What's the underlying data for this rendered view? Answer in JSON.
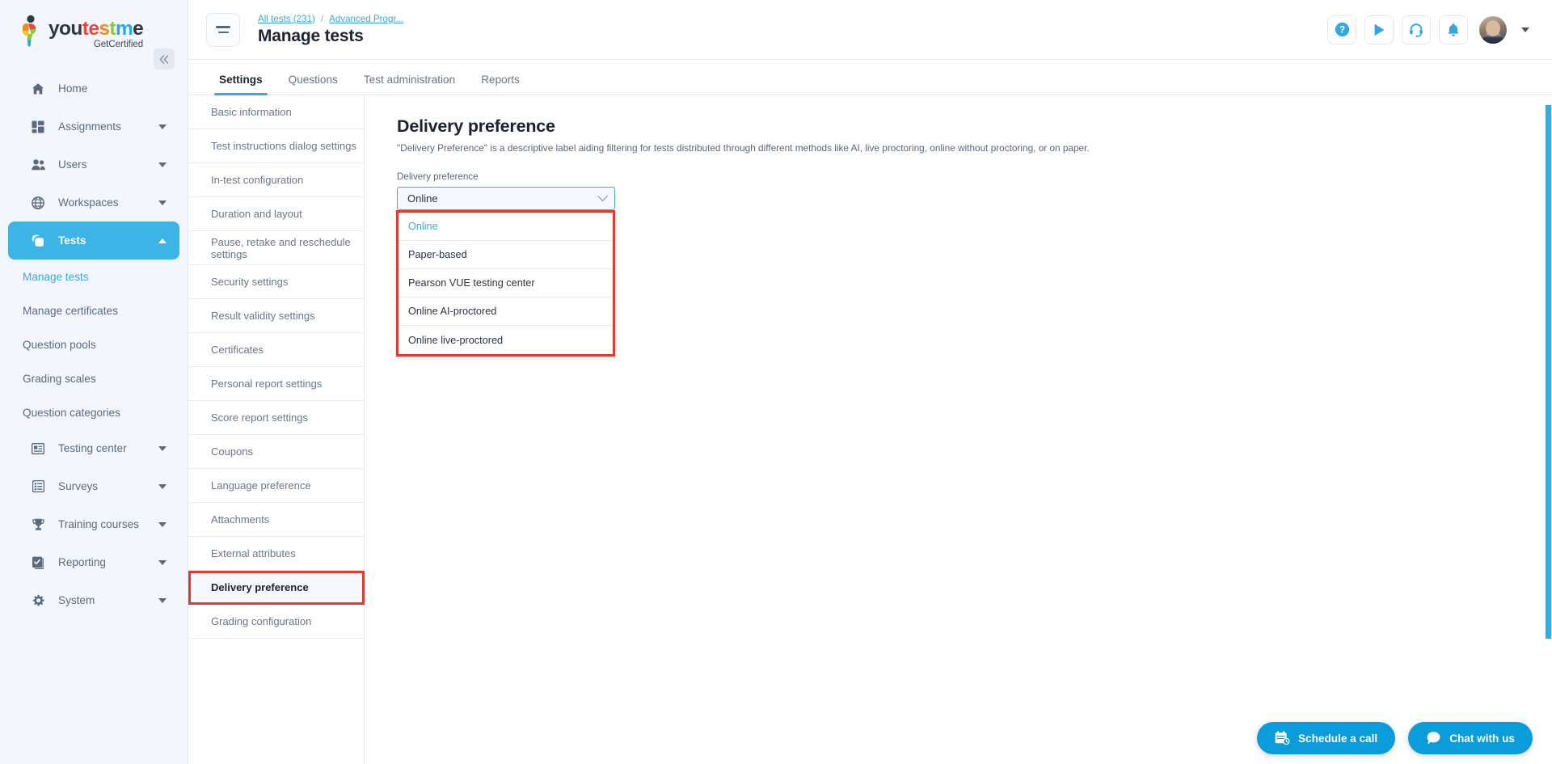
{
  "brand": {
    "name_you": "you",
    "name_test": "test",
    "name_me": "me",
    "tagline": "GetCertified",
    "collapse_icon": "double-chevron-left-icon",
    "accent_color": "#3cb4e5",
    "highlight_color": "#e23b2e"
  },
  "sidebar": {
    "items": [
      {
        "label": "Home",
        "icon": "home-icon",
        "expandable": false,
        "active": false
      },
      {
        "label": "Assignments",
        "icon": "assignments-grid-icon",
        "expandable": true,
        "active": false
      },
      {
        "label": "Users",
        "icon": "users-icon",
        "expandable": true,
        "active": false
      },
      {
        "label": "Workspaces",
        "icon": "globe-icon",
        "expandable": true,
        "active": false
      },
      {
        "label": "Tests",
        "icon": "tests-layers-icon",
        "expandable": true,
        "active": true
      }
    ],
    "tests_subitems": [
      {
        "label": "Manage tests",
        "current": true
      },
      {
        "label": "Manage certificates",
        "current": false
      },
      {
        "label": "Question pools",
        "current": false
      },
      {
        "label": "Grading scales",
        "current": false
      },
      {
        "label": "Question categories",
        "current": false
      }
    ],
    "items_after": [
      {
        "label": "Testing center",
        "icon": "testing-center-icon",
        "expandable": true
      },
      {
        "label": "Surveys",
        "icon": "surveys-list-icon",
        "expandable": true
      },
      {
        "label": "Training courses",
        "icon": "trophy-icon",
        "expandable": true
      },
      {
        "label": "Reporting",
        "icon": "reporting-check-icon",
        "expandable": true
      },
      {
        "label": "System",
        "icon": "gear-icon",
        "expandable": true
      }
    ]
  },
  "header": {
    "menu_icon": "hamburger-icon",
    "breadcrumb": [
      {
        "label": "All tests (231)",
        "link": true
      },
      {
        "label": "/",
        "link": false
      },
      {
        "label": "Advanced Progr...",
        "link": true
      }
    ],
    "title": "Manage tests",
    "actions": [
      {
        "name": "help-icon",
        "label": "Help"
      },
      {
        "name": "play-icon",
        "label": "Play tutorial"
      },
      {
        "name": "headset-support-icon",
        "label": "Support"
      },
      {
        "name": "bell-notification-icon",
        "label": "Notifications"
      }
    ],
    "avatar": "user-avatar",
    "avatar_caret": "chevron-down-icon"
  },
  "tabs": [
    {
      "label": "Settings",
      "active": true
    },
    {
      "label": "Questions",
      "active": false
    },
    {
      "label": "Test administration",
      "active": false
    },
    {
      "label": "Reports",
      "active": false
    }
  ],
  "settings_list": [
    {
      "label": "Basic information",
      "selected": false
    },
    {
      "label": "Test instructions dialog settings",
      "selected": false
    },
    {
      "label": "In-test configuration",
      "selected": false
    },
    {
      "label": "Duration and layout",
      "selected": false
    },
    {
      "label": "Pause, retake and reschedule settings",
      "selected": false
    },
    {
      "label": "Security settings",
      "selected": false
    },
    {
      "label": "Result validity settings",
      "selected": false
    },
    {
      "label": "Certificates",
      "selected": false
    },
    {
      "label": "Personal report settings",
      "selected": false
    },
    {
      "label": "Score report settings",
      "selected": false
    },
    {
      "label": "Coupons",
      "selected": false
    },
    {
      "label": "Language preference",
      "selected": false
    },
    {
      "label": "Attachments",
      "selected": false
    },
    {
      "label": "External attributes",
      "selected": false
    },
    {
      "label": "Delivery preference",
      "selected": true
    },
    {
      "label": "Grading configuration",
      "selected": false
    }
  ],
  "panel": {
    "title": "Delivery preference",
    "description": "\"Delivery Preference\" is a descriptive label aiding filtering for tests distributed through different methods like AI, live proctoring, online without proctoring, or on paper.",
    "field_label": "Delivery preference",
    "select_value": "Online",
    "select_chevron": "chevron-down-icon",
    "options": [
      {
        "label": "Online",
        "selected": true
      },
      {
        "label": "Paper-based",
        "selected": false
      },
      {
        "label": "Pearson VUE testing center",
        "selected": false
      },
      {
        "label": "Online AI-proctored",
        "selected": false
      },
      {
        "label": "Online live-proctored",
        "selected": false
      }
    ]
  },
  "floating_buttons": [
    {
      "label": "Schedule a call",
      "icon": "calendar-clock-icon"
    },
    {
      "label": "Chat with us",
      "icon": "chat-bubble-icon"
    }
  ],
  "scrollbar": {
    "name": "page-scrollbar"
  }
}
